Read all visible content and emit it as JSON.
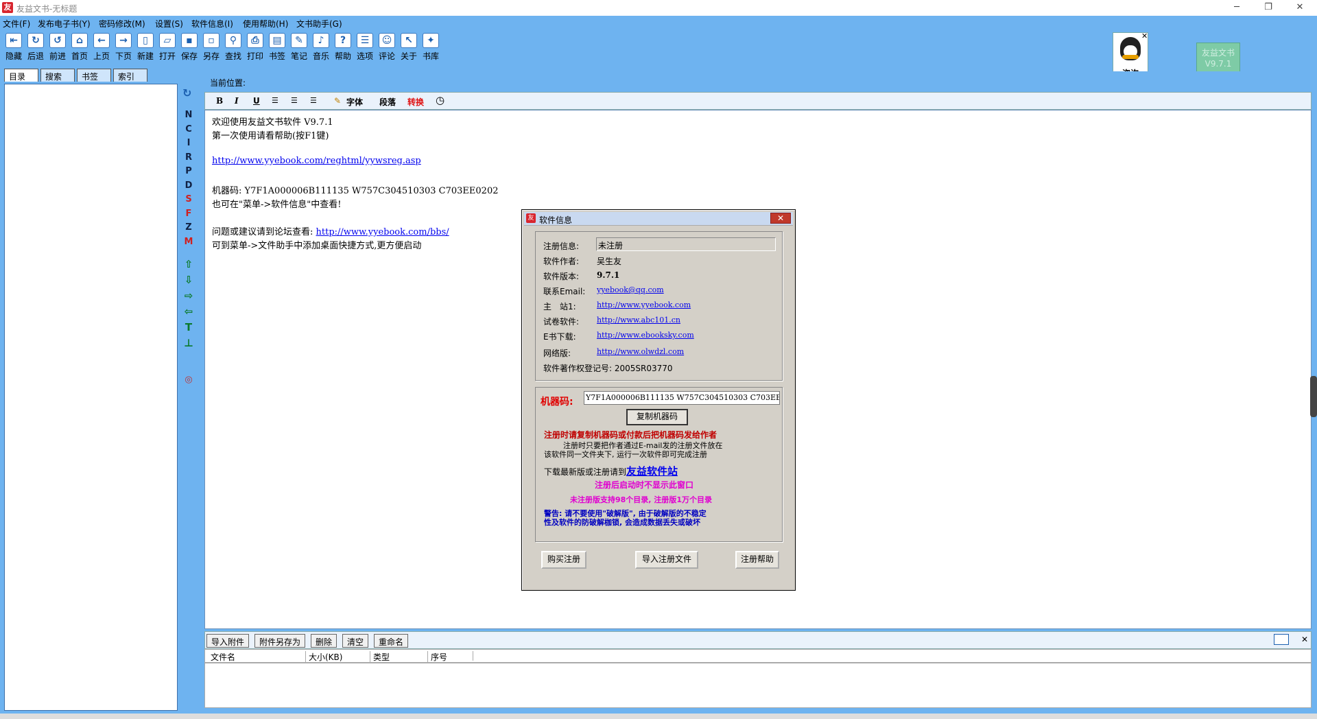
{
  "window": {
    "title": "友益文书-无标题",
    "min": "─",
    "restore": "❐",
    "close": "✕"
  },
  "menu": [
    "文件(F)",
    "发布电子书(Y)",
    "密码修改(M)",
    "设置(S)",
    "软件信息(I)",
    "使用帮助(H)",
    "文书助手(G)"
  ],
  "toolbar": [
    {
      "label": "隐藏",
      "icon": "hide-icon",
      "glyph": "⇤"
    },
    {
      "label": "后退",
      "icon": "back-icon",
      "glyph": "↻"
    },
    {
      "label": "前进",
      "icon": "forward-icon",
      "glyph": "↺"
    },
    {
      "label": "首页",
      "icon": "home-icon",
      "glyph": "⌂"
    },
    {
      "label": "上页",
      "icon": "prev-page-icon",
      "glyph": "←"
    },
    {
      "label": "下页",
      "icon": "next-page-icon",
      "glyph": "→"
    },
    {
      "label": "新建",
      "icon": "new-icon",
      "glyph": "▯"
    },
    {
      "label": "打开",
      "icon": "open-icon",
      "glyph": "▱"
    },
    {
      "label": "保存",
      "icon": "save-icon",
      "glyph": "▪"
    },
    {
      "label": "另存",
      "icon": "save-as-icon",
      "glyph": "▫"
    },
    {
      "label": "查找",
      "icon": "find-icon",
      "glyph": "⚲"
    },
    {
      "label": "打印",
      "icon": "print-icon",
      "glyph": "⎙"
    },
    {
      "label": "书签",
      "icon": "bookmark-icon",
      "glyph": "▤"
    },
    {
      "label": "笔记",
      "icon": "note-icon",
      "glyph": "✎"
    },
    {
      "label": "音乐",
      "icon": "music-icon",
      "glyph": "♪"
    },
    {
      "label": "帮助",
      "icon": "help-icon",
      "glyph": "?"
    },
    {
      "label": "选项",
      "icon": "options-icon",
      "glyph": "☰"
    },
    {
      "label": "评论",
      "icon": "comment-icon",
      "glyph": "☺"
    },
    {
      "label": "关于",
      "icon": "about-icon",
      "glyph": "↖"
    },
    {
      "label": "书库",
      "icon": "library-icon",
      "glyph": "✦"
    }
  ],
  "qq": {
    "label": "咨询",
    "close": "✕"
  },
  "version_badge": {
    "line1": "友益文书",
    "line2": "V9.7.1"
  },
  "left_tabs": [
    "目录",
    "搜索",
    "书签",
    "索引"
  ],
  "sidebar_letters": [
    {
      "t": "N",
      "c": "#112244"
    },
    {
      "t": "C",
      "c": "#112244"
    },
    {
      "t": "I",
      "c": "#112244"
    },
    {
      "t": "R",
      "c": "#112244"
    },
    {
      "t": "P",
      "c": "#112244"
    },
    {
      "t": "D",
      "c": "#112244"
    },
    {
      "t": "S",
      "c": "#d02020"
    },
    {
      "t": "F",
      "c": "#d02020"
    },
    {
      "t": "Z",
      "c": "#112244"
    },
    {
      "t": "M",
      "c": "#d02020"
    }
  ],
  "sidebar_arrows": [
    "⇧",
    "⇩",
    "⇨",
    "⇦",
    "T",
    "⊥"
  ],
  "location_label": "当前位置:",
  "editor_toolbar": {
    "bold": "B",
    "italic": "I",
    "underline": "U",
    "font": "字体",
    "para": "段落",
    "convert": "转换",
    "clock": "◷",
    "brush": "✎"
  },
  "editor": {
    "line1": "欢迎使用友益文书软件 V9.7.1",
    "line2": "第一次使用请看帮助(按F1键)",
    "link1": "http://www.yyebook.com/reghtml/yywsreg.asp",
    "line3": "机器码: Y7F1A000006B111135 W757C304510303 C703EE0202",
    "line4": "也可在\"菜单->软件信息\"中查看!",
    "line5_prefix": "问题或建议请到论坛查看: ",
    "link2": "http://www.yyebook.com/bbs/",
    "line6": "可到菜单->文件助手中添加桌面快捷方式,更方便启动"
  },
  "attach": {
    "buttons": [
      "导入附件",
      "附件另存为",
      "删除",
      "清空",
      "重命名"
    ],
    "cols": [
      "文件名",
      "大小(KB)",
      "类型",
      "序号"
    ],
    "close": "✕"
  },
  "dialog": {
    "title": "软件信息",
    "close": "✕",
    "reg_label": "注册信息:",
    "reg_value": "未注册",
    "author_label": "软件作者:",
    "author_value": "吴生友",
    "ver_label": "软件版本:",
    "ver_value": "9.7.1",
    "email_label": "联系Email:",
    "email_value": "yyebook@qq.com",
    "site_label": "主　站1:",
    "site_value": "http://www.yyebook.com",
    "exam_label": "试卷软件:",
    "exam_value": "http://www.abc101.cn",
    "ebook_label": "E书下载:",
    "ebook_value": "http://www.ebooksky.com",
    "net_label": "网络版:",
    "net_value": "http://www.olwdzl.com",
    "copyright": "软件著作权登记号: 2005SR03770",
    "machine_label": "机器码:",
    "machine_value": "Y7F1A000006B111135 W757C304510303 C703EE0",
    "copy_btn": "复制机器码",
    "warn1": "注册时请复制机器码或付款后把机器码发给作者",
    "info1": "注册时只要把作者通过E-mail发的注册文件放在",
    "info2": "该软件同一文件夹下, 运行一次软件即可完成注册",
    "download_prefix": "下载最新版或注册请到",
    "download_link": "友益软件站",
    "note1": "注册后启动时不显示此窗口",
    "note2": "未注册版支持98个目录, 注册版1万个目录",
    "warn2a": "警告: 请不要使用\"破解版\", 由于破解版的不稳定",
    "warn2b": "性及软件的防破解枷锁, 会造成数据丢失或破坏",
    "buy_btn": "购买注册",
    "import_btn": "导入注册文件",
    "help_btn": "注册帮助"
  }
}
